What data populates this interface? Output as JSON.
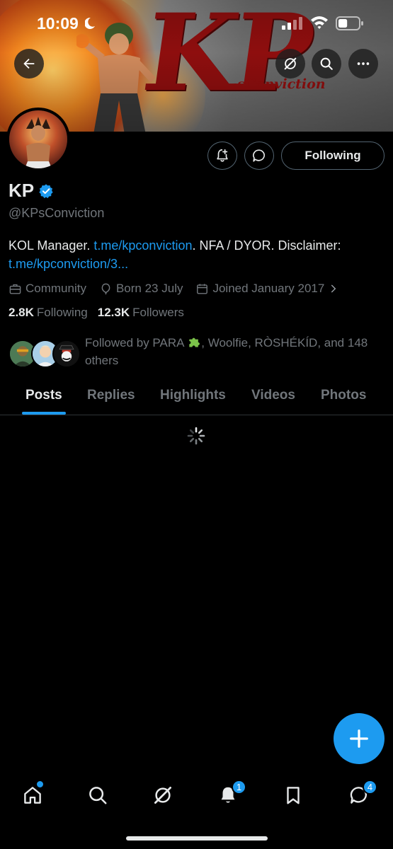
{
  "status_bar": {
    "time": "10:09",
    "battery_level": 0.45
  },
  "banner": {
    "art_title": "KP",
    "art_subtitle": "sConviction"
  },
  "header": {
    "back_icon": "arrow-left-icon",
    "grok_icon": "grok-icon",
    "search_icon": "search-icon",
    "more_icon": "more-icon"
  },
  "profile": {
    "name": "KP",
    "verified": true,
    "handle": "@KPsConviction",
    "follow_label": "Following",
    "bio_prefix": "KOL Manager. ",
    "bio_link1": "t.me/kpconviction",
    "bio_middle": ". NFA / DYOR. Disclaimer: ",
    "bio_link2": "t.me/kpconviction/3...",
    "category": "Community",
    "born": "Born 23 July",
    "joined": "Joined January 2017",
    "following_count": "2.8K",
    "following_label": "Following",
    "followers_count": "12.3K",
    "followers_label": "Followers",
    "followed_by_prefix": "Followed by PARA",
    "followed_by_suffix": ", Woolfie, RÒSHÉKÍD, and 148 others"
  },
  "tabs": [
    {
      "label": "Posts",
      "active": true
    },
    {
      "label": "Replies",
      "active": false
    },
    {
      "label": "Highlights",
      "active": false
    },
    {
      "label": "Videos",
      "active": false
    },
    {
      "label": "Photos",
      "active": false
    }
  ],
  "bottom_nav": {
    "notifications_badge": "1",
    "messages_badge": "4"
  },
  "colors": {
    "accent": "#1d9bf0",
    "background": "#000000",
    "text_primary": "#e7e9ea",
    "text_secondary": "#71767b"
  }
}
